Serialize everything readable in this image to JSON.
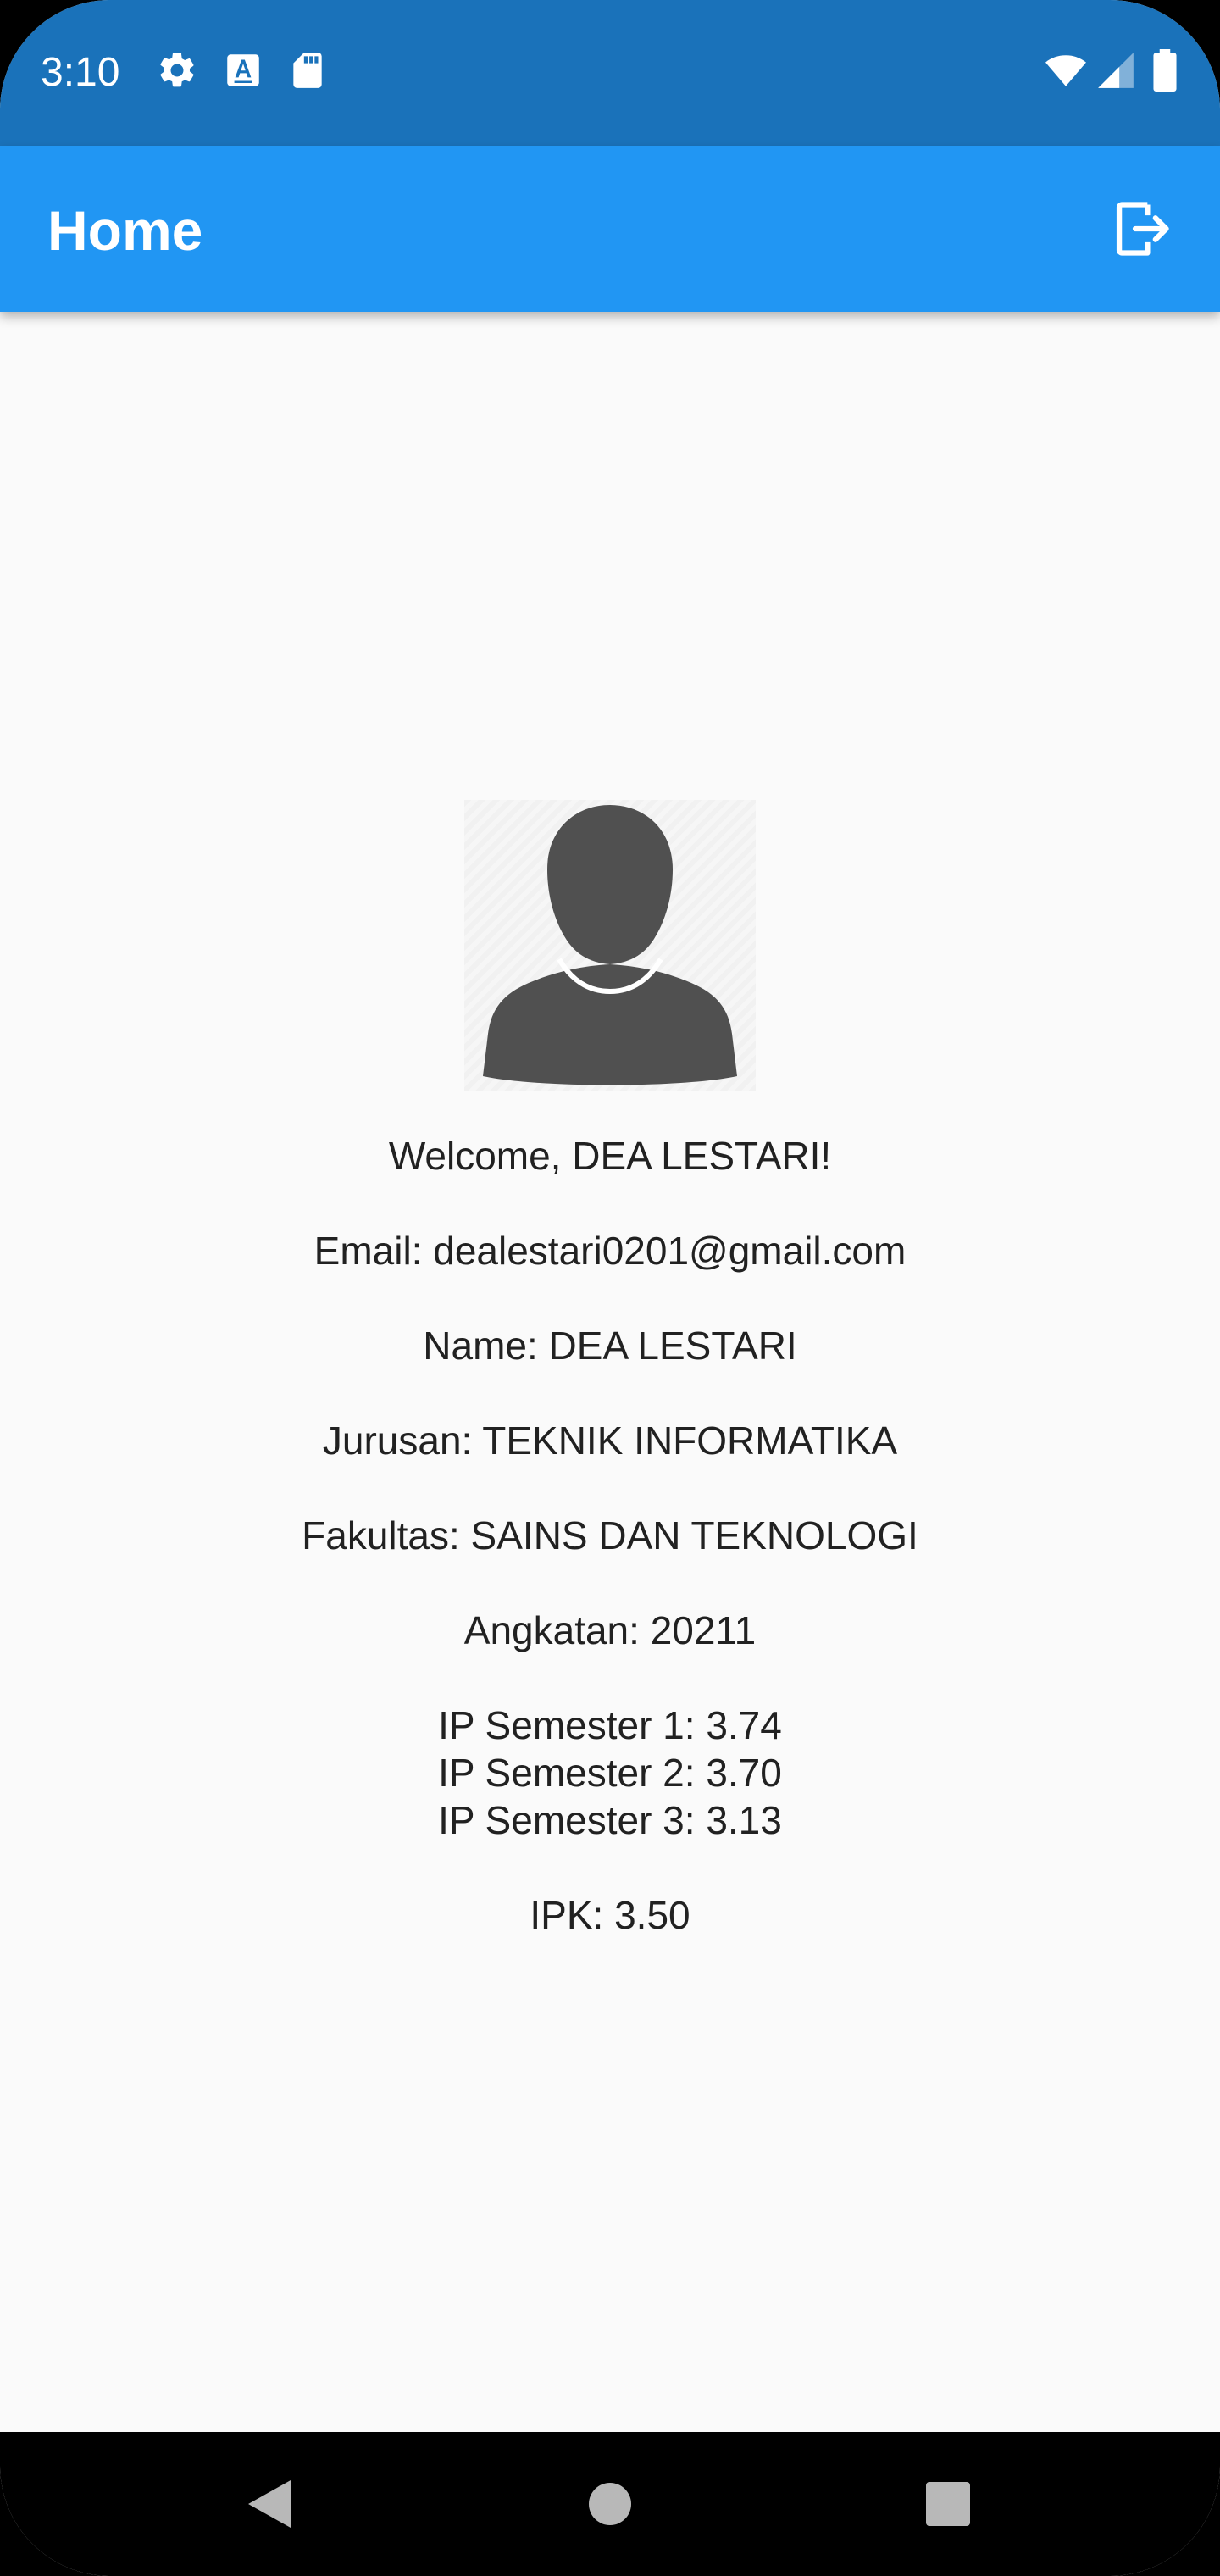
{
  "status_bar": {
    "time": "3:10",
    "icons": [
      "gear-icon",
      "text-a-icon",
      "sd-card-icon",
      "wifi-icon",
      "signal-icon",
      "battery-icon"
    ]
  },
  "app_bar": {
    "title": "Home",
    "logout_icon": "logout-icon",
    "background": "#2196f3"
  },
  "profile": {
    "avatar_icon": "person-silhouette-icon",
    "welcome": "Welcome, DEA LESTARI!",
    "email": "Email: dealestari0201@gmail.com",
    "name": "Name: DEA LESTARI",
    "jurusan": "Jurusan: TEKNIK INFORMATIKA",
    "fakultas": "Fakultas: SAINS DAN TEKNOLOGI",
    "angkatan": "Angkatan: 20211",
    "ip_semesters": [
      "IP Semester 1: 3.74",
      "IP Semester 2: 3.70",
      "IP Semester 3: 3.13"
    ],
    "ipk": "IPK: 3.50"
  },
  "nav_bar": {
    "buttons": [
      "back-icon",
      "home-icon",
      "recents-icon"
    ]
  }
}
